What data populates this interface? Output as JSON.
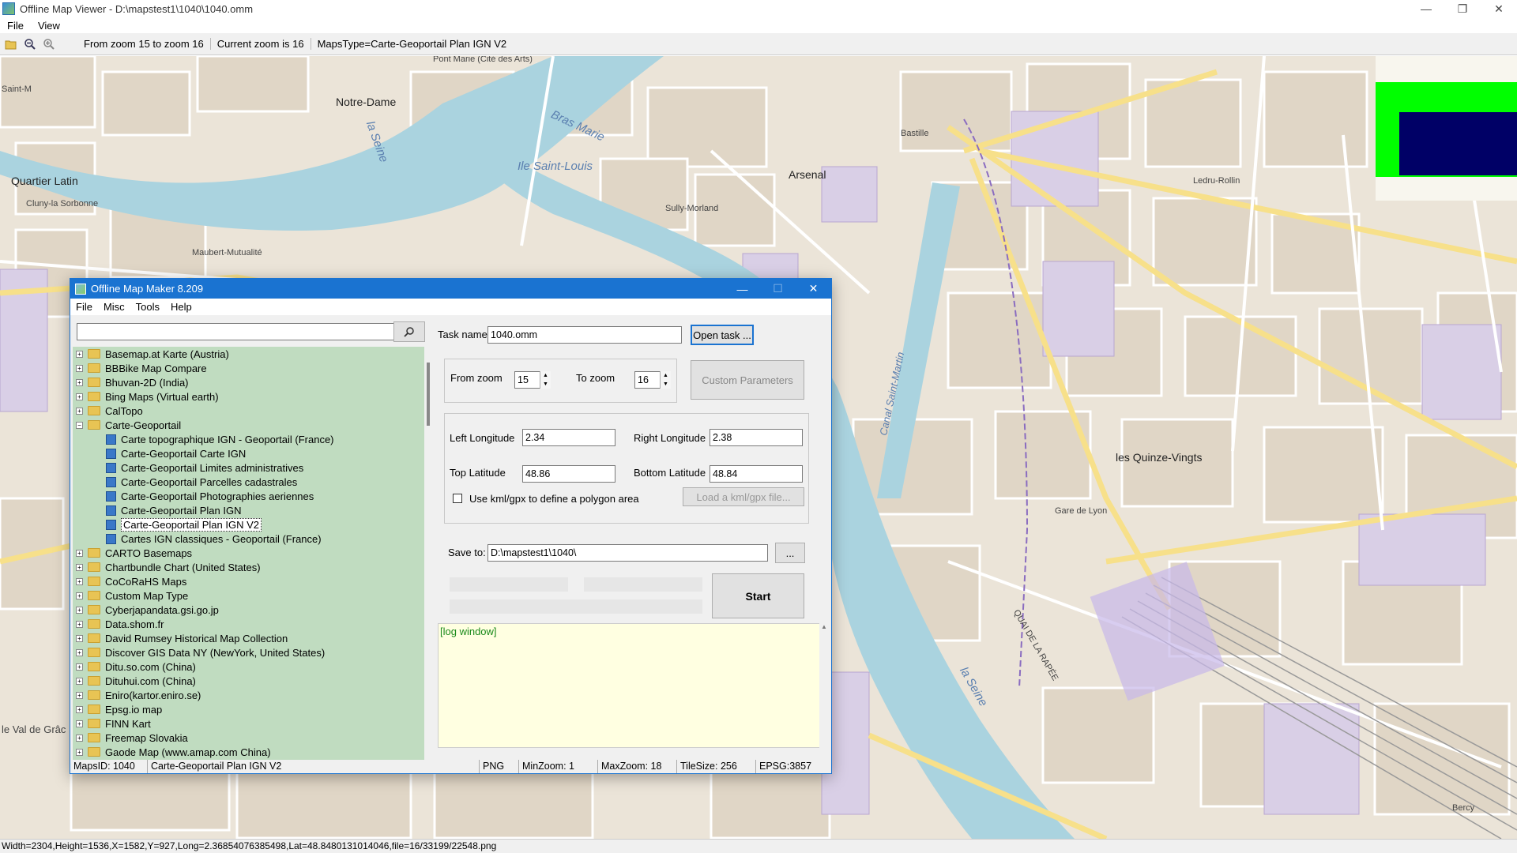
{
  "window": {
    "title": "Offline Map Viewer - D:\\mapstest1\\1040\\1040.omm",
    "menu": [
      "File",
      "View"
    ]
  },
  "toolbar": {
    "zoom_range": "From zoom 15 to zoom 16",
    "current_zoom": "Current zoom is 16",
    "maps_type": "MapsType=Carte-Geoportail Plan IGN V2"
  },
  "map_labels": {
    "notre_dame": "Notre-Dame",
    "quartier_latin": "Quartier Latin",
    "ile_saint_louis": "Ile Saint-Louis",
    "bras_marie": "Bras Marie",
    "la_seine_1": "la Seine",
    "la_seine_2": "la Seine",
    "arsenal": "Arsenal",
    "bastille": "Bastille",
    "quinze_vingts": "les Quinze-Vingts",
    "canal": "Canal Saint-Martin",
    "gare_de_lyon": "Gare de Lyon",
    "sully_morland": "Sully-Morland",
    "maubert": "Maubert-Mutualité",
    "ledru_rollin": "Ledru-Rollin",
    "val_de_grace": "le Val de Grâc",
    "pont_marie": "Pont Marie (Cité des Arts)",
    "saint_michel": "Saint-M",
    "cluny": "Cluny-la Sorbonne",
    "bercy": "Bercy",
    "quai_rapee": "QUAI DE LA RAPÉE"
  },
  "status_bar": "Width=2304,Height=1536,X=1582,Y=927,Long=2.36854076385498,Lat=48.8480131014046,file=16/33199/22548.png",
  "dialog": {
    "title": "Offline Map Maker 8.209",
    "menu": [
      "File",
      "Misc",
      "Tools",
      "Help"
    ],
    "search_value": "",
    "tree": [
      {
        "type": "folder",
        "label": "Basemap.at Karte (Austria)",
        "exp": "+"
      },
      {
        "type": "folder",
        "label": "BBBike Map Compare",
        "exp": "+"
      },
      {
        "type": "folder",
        "label": "Bhuvan-2D (India)",
        "exp": "+"
      },
      {
        "type": "folder",
        "label": "Bing Maps (Virtual earth)",
        "exp": "+"
      },
      {
        "type": "folder",
        "label": "CalTopo",
        "exp": "+"
      },
      {
        "type": "folder",
        "label": "Carte-Geoportail",
        "exp": "−"
      },
      {
        "type": "leaf",
        "label": "Carte topographique IGN - Geoportail (France)"
      },
      {
        "type": "leaf",
        "label": "Carte-Geoportail Carte IGN"
      },
      {
        "type": "leaf",
        "label": "Carte-Geoportail Limites administratives"
      },
      {
        "type": "leaf",
        "label": "Carte-Geoportail Parcelles cadastrales"
      },
      {
        "type": "leaf",
        "label": "Carte-Geoportail Photographies aeriennes"
      },
      {
        "type": "leaf",
        "label": "Carte-Geoportail Plan IGN"
      },
      {
        "type": "leaf",
        "label": "Carte-Geoportail Plan IGN V2",
        "selected": true
      },
      {
        "type": "leaf",
        "label": "Cartes IGN classiques - Geoportail (France)"
      },
      {
        "type": "folder",
        "label": "CARTO Basemaps",
        "exp": "+"
      },
      {
        "type": "folder",
        "label": "Chartbundle Chart (United States)",
        "exp": "+"
      },
      {
        "type": "folder",
        "label": "CoCoRaHS Maps",
        "exp": "+"
      },
      {
        "type": "folder",
        "label": "Custom Map Type",
        "exp": "+"
      },
      {
        "type": "folder",
        "label": "Cyberjapandata.gsi.go.jp",
        "exp": "+"
      },
      {
        "type": "folder",
        "label": "Data.shom.fr",
        "exp": "+"
      },
      {
        "type": "folder",
        "label": "David Rumsey Historical Map Collection",
        "exp": "+"
      },
      {
        "type": "folder",
        "label": "Discover GIS Data NY (NewYork, United States)",
        "exp": "+"
      },
      {
        "type": "folder",
        "label": "Ditu.so.com (China)",
        "exp": "+"
      },
      {
        "type": "folder",
        "label": "Dituhui.com (China)",
        "exp": "+"
      },
      {
        "type": "folder",
        "label": "Eniro(kartor.eniro.se)",
        "exp": "+"
      },
      {
        "type": "folder",
        "label": "Epsg.io map",
        "exp": "+"
      },
      {
        "type": "folder",
        "label": "FINN Kart",
        "exp": "+"
      },
      {
        "type": "folder",
        "label": "Freemap Slovakia",
        "exp": "+"
      },
      {
        "type": "folder",
        "label": "Gaode Map (www.amap.com China)",
        "exp": "+"
      }
    ],
    "task_name_label": "Task name",
    "task_name_value": "1040.omm",
    "open_task_label": "Open task ...",
    "from_zoom_label": "From zoom",
    "from_zoom_value": "15",
    "to_zoom_label": "To zoom",
    "to_zoom_value": "16",
    "custom_params_label": "Custom Parameters",
    "left_lon_label": "Left Longitude",
    "left_lon_value": "2.34",
    "right_lon_label": "Right Longitude",
    "right_lon_value": "2.38",
    "top_lat_label": "Top Latitude",
    "top_lat_value": "48.86",
    "bottom_lat_label": "Bottom Latitude",
    "bottom_lat_value": "48.84",
    "kml_label": "Use kml/gpx to define a polygon area",
    "load_kml_label": "Load a kml/gpx file...",
    "save_to_label": "Save to:",
    "save_to_value": "D:\\mapstest1\\1040\\",
    "browse_label": "...",
    "start_label": "Start",
    "log_label": "[log window]",
    "status": {
      "maps_id": "MapsID: 1040",
      "name": "Carte-Geoportail Plan IGN V2",
      "format": "PNG",
      "min_zoom": "MinZoom: 1",
      "max_zoom": "MaxZoom: 18",
      "tile_size": "TileSize: 256",
      "epsg": "EPSG:3857"
    }
  },
  "colors": {
    "dialog_accent": "#1a73d1",
    "tree_bg": "#c0dcc0",
    "log_bg": "#ffffe1",
    "water": "#aad3df",
    "green_overlay": "#00ff00",
    "navy_overlay": "#000066"
  }
}
